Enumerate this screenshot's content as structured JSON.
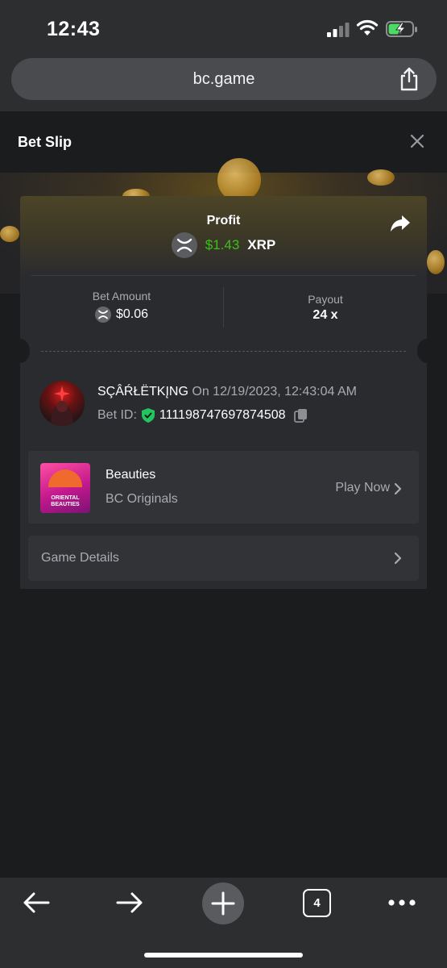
{
  "status_bar": {
    "time": "12:43"
  },
  "browser": {
    "url": "bc.game",
    "tab_count": "4"
  },
  "slip": {
    "title": "Bet Slip"
  },
  "profit": {
    "label": "Profit",
    "value": "$1.43",
    "currency": "XRP"
  },
  "bet_amount": {
    "label": "Bet Amount",
    "value": "$0.06"
  },
  "payout": {
    "label": "Payout",
    "value": "24 x"
  },
  "bet_info": {
    "username": "SÇÂŔŁËTKĮNG",
    "on_text": "On 12/19/2023, 12:43:04 AM",
    "bet_id_label": "Bet ID:",
    "bet_id": "111198747697874508"
  },
  "game": {
    "title": "Beauties",
    "provider": "BC Originals",
    "play_label": "Play Now",
    "thumb_text": "ORIENTAL BEAUTIES"
  },
  "details": {
    "label": "Game Details"
  },
  "colors": {
    "profit_green": "#3bc117",
    "shield_green": "#22c55e",
    "battery_green": "#4cd964"
  },
  "icons": [
    "signal-icon",
    "wifi-icon",
    "battery-icon",
    "share-icon",
    "close-icon",
    "xrp-icon",
    "forward-arrow-icon",
    "shield-check-icon",
    "copy-icon",
    "chevron-right-icon",
    "back-arrow-icon",
    "next-arrow-icon",
    "plus-icon",
    "tabs-icon",
    "more-icon"
  ]
}
